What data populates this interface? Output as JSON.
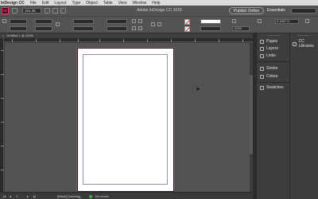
{
  "menubar": {
    "app": "InDesign CC",
    "items": [
      "File",
      "Edit",
      "Layout",
      "Type",
      "Object",
      "Table",
      "View",
      "Window",
      "Help"
    ]
  },
  "appbar": {
    "logo": "Id",
    "zoom_value": "101.36",
    "title": "Adobe InDesign CC 2018",
    "publish_label": "Publish Online",
    "workspace_label": "Essentials"
  },
  "controlbar": {
    "stroke_weight_value": "",
    "percent_value": "100%",
    "offset_value": "0.1667 in"
  },
  "document_tab": {
    "close": "×",
    "label": "Untitled-1 @ 100%"
  },
  "panels": {
    "items": [
      "Pages",
      "Layers",
      "Links",
      "Stroke",
      "Colour",
      "Swatches"
    ],
    "libraries": "CC Libraries"
  },
  "statusbar": {
    "page": "1",
    "preflight_profile": "[Basic] (working)",
    "errors": "No errors"
  },
  "colors": {
    "indesign_accent": "#ff3366",
    "error_none": "#3fae3f"
  }
}
